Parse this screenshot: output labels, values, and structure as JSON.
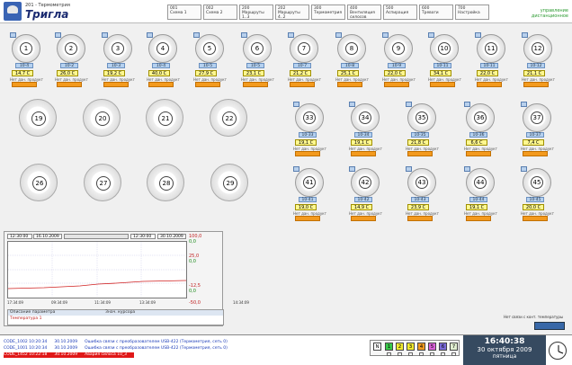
{
  "header": {
    "subtitle": "201 - Термометрия",
    "title": "Тригла",
    "tabs": [
      {
        "num": "001",
        "label": "Схема 1"
      },
      {
        "num": "002",
        "label": "Схема 2"
      },
      {
        "num": "200",
        "label": "Маршруты 1..3"
      },
      {
        "num": "202",
        "label": "Маршруты 4..2"
      },
      {
        "num": "300",
        "label": "Термометрия"
      },
      {
        "num": "400",
        "label": "Вентиляция силосов"
      },
      {
        "num": "500",
        "label": "Аспирация"
      },
      {
        "num": "600",
        "label": "Тревоги"
      },
      {
        "num": "700",
        "label": "Настройка"
      }
    ],
    "mode": "управление дистанционное"
  },
  "silos_small": [
    {
      "num": "1",
      "temp": "14,7 С",
      "code": "10-4"
    },
    {
      "num": "2",
      "temp": "26,0 С",
      "code": "10-2"
    },
    {
      "num": "3",
      "temp": "19,2 С",
      "code": "10-3"
    },
    {
      "num": "4",
      "temp": "40,0 С",
      "code": "10-4"
    },
    {
      "num": "5",
      "temp": "27,9 С",
      "code": "10-5"
    },
    {
      "num": "6",
      "temp": "23,1 С",
      "code": "10-5"
    },
    {
      "num": "7",
      "temp": "21,2 С",
      "code": "10-7"
    },
    {
      "num": "8",
      "temp": "25,1 С",
      "code": "10-8"
    },
    {
      "num": "9",
      "temp": "22,0 С",
      "code": "10-9"
    },
    {
      "num": "10",
      "temp": "34,1 С",
      "code": "10-11"
    },
    {
      "num": "11",
      "temp": "22,0 С",
      "code": "10-11"
    },
    {
      "num": "12",
      "temp": "21,1 С",
      "code": "10-12"
    },
    {
      "num": "33",
      "temp": "19,1 С",
      "code": "10-33"
    },
    {
      "num": "34",
      "temp": "19,1 С",
      "code": "10-34"
    },
    {
      "num": "35",
      "temp": "21,8 С",
      "code": "10-35"
    },
    {
      "num": "36",
      "temp": "6,6 С",
      "code": "10-36"
    },
    {
      "num": "37",
      "temp": "7,4 С",
      "code": "10-37"
    },
    {
      "num": "41",
      "temp": "19,0 С",
      "code": "10-41"
    },
    {
      "num": "42",
      "temp": "14,9 С",
      "code": "10-42"
    },
    {
      "num": "43",
      "temp": "23,9 С",
      "code": "10-43"
    },
    {
      "num": "44",
      "temp": "19,1 С",
      "code": "10-44"
    },
    {
      "num": "45",
      "temp": "20,0 С",
      "code": "10-45"
    }
  ],
  "silo_status": "Нет дан. продукт",
  "silos_big": [
    "19",
    "20",
    "21",
    "22",
    "26",
    "27",
    "28",
    "29"
  ],
  "trend": {
    "start_time": "12:30:00",
    "start_date": "16.10.2009",
    "end_time": "12:30:00",
    "end_date": "30.10.2009",
    "y_labels": [
      "100,0",
      "0,0",
      "25,0",
      "0,0",
      "-12,5",
      "0,0",
      "-50,0"
    ],
    "x_labels": [
      "17:34:09",
      "09:34:09",
      "11:34:09",
      "13:34:09",
      "14:34:09"
    ],
    "col_param": "Описание параметра",
    "col_cursor": "Знач. курсора",
    "row_param": "Температура 1"
  },
  "bottom_note": "Нет связи с конт. температуры",
  "log": [
    {
      "id": "CODE_1002 10:20:34",
      "date": "30.10.2009",
      "msg": "Ошибка связи с преобразователем USB-422 (Термометрия, сеть 0)",
      "alarm": false
    },
    {
      "id": "CODE_1001 10:20:34",
      "date": "30.10.2009",
      "msg": "Ошибка связи с преобразователем USB-422 (Термометрия, сеть 0)",
      "alarm": false
    },
    {
      "id": "CODE_1452 10:22:18",
      "date": "30.10.2009",
      "msg": "Авария силоса 10_3",
      "alarm": true
    }
  ],
  "networks": {
    "label": "N",
    "items": [
      {
        "n": "1",
        "color": "#38c848"
      },
      {
        "n": "2",
        "color": "#f0ea30"
      },
      {
        "n": "3",
        "color": "#f0ea30"
      },
      {
        "n": "4",
        "color": "#f09a20"
      },
      {
        "n": "5",
        "color": "#d860d8"
      },
      {
        "n": "6",
        "color": "#7a6ad8"
      },
      {
        "n": "7",
        "color": "#e0eed0"
      }
    ]
  },
  "clock": {
    "time": "16:40:38",
    "date": "30 октября 2009",
    "weekday": "пятница"
  }
}
